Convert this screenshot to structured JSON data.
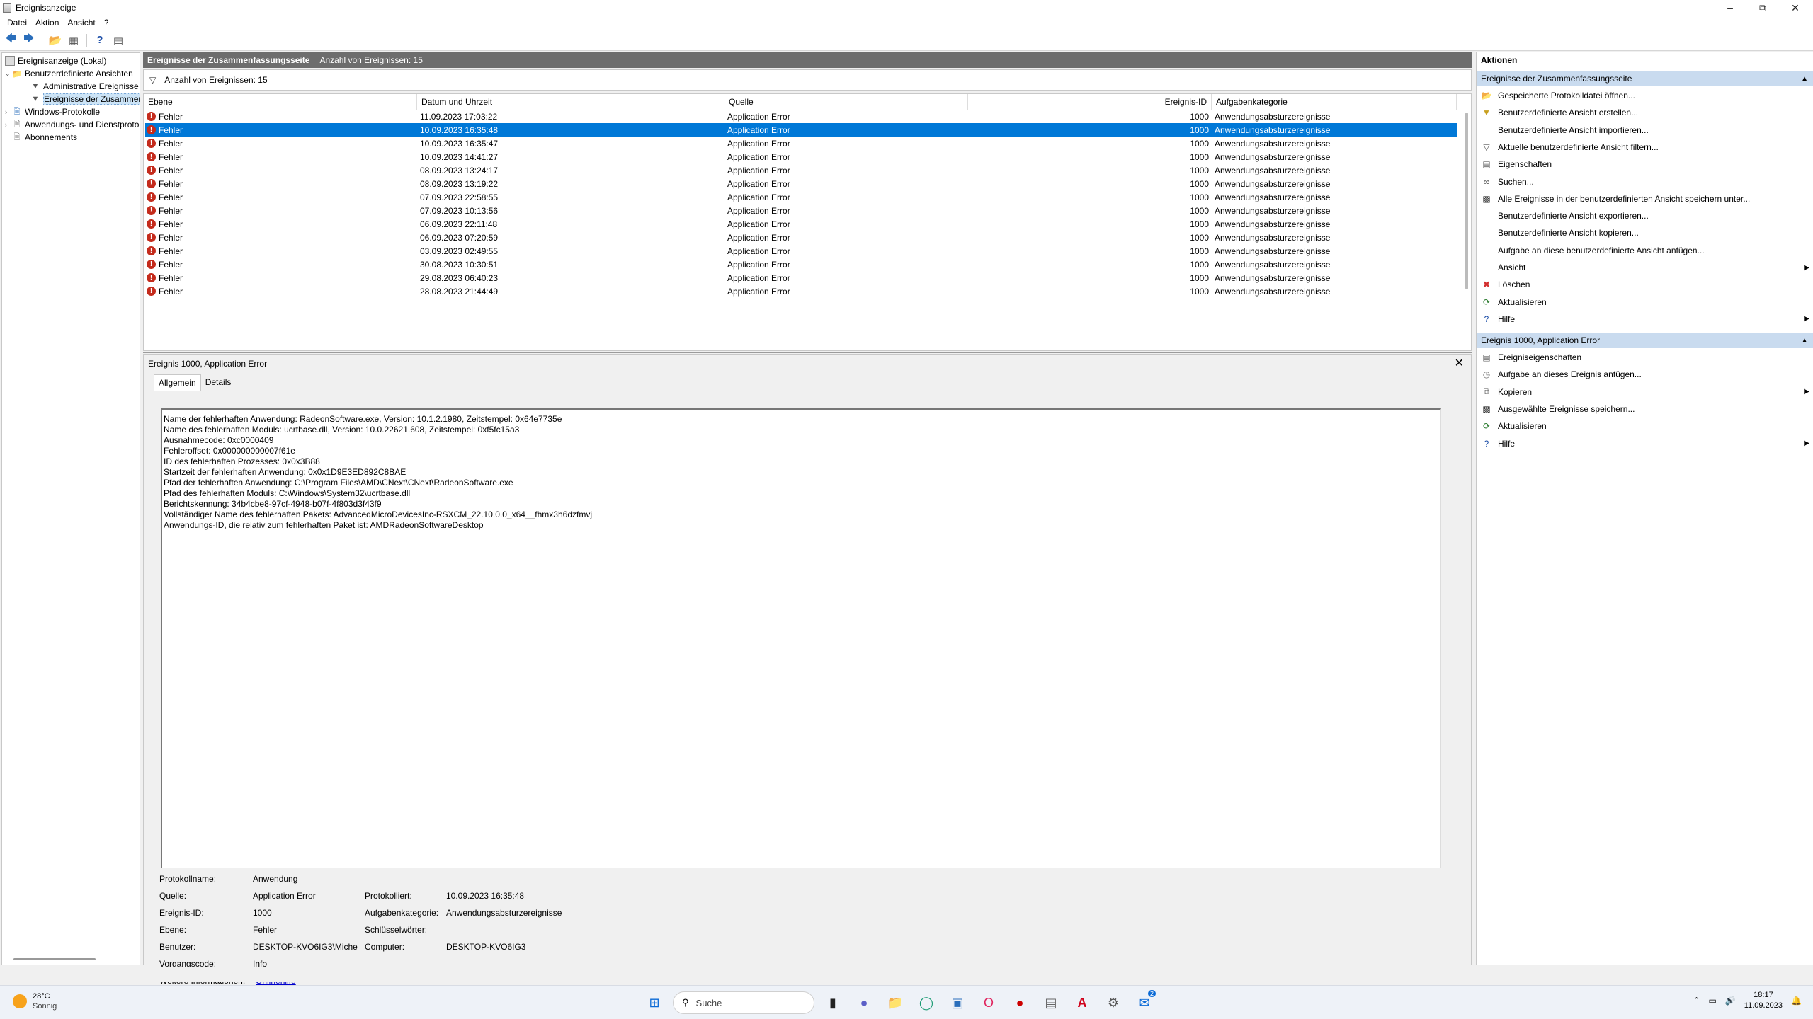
{
  "window": {
    "title": "Ereignisanzeige"
  },
  "menu": [
    "Datei",
    "Aktion",
    "Ansicht",
    "?"
  ],
  "tree": {
    "root": "Ereignisanzeige (Lokal)",
    "custom_views": "Benutzerdefinierte Ansichten",
    "admin_events": "Administrative Ereignisse",
    "summary_events": "Ereignisse der Zusammenfassungsseite",
    "windows_logs": "Windows-Protokolle",
    "app_service_logs": "Anwendungs- und Dienstprotokolle",
    "subscriptions": "Abonnements"
  },
  "center": {
    "header_title": "Ereignisse der Zusammenfassungsseite",
    "header_count": "Anzahl von Ereignissen: 15",
    "filter_text": "Anzahl von Ereignissen: 15",
    "columns": [
      "Ebene",
      "Datum und Uhrzeit",
      "Quelle",
      "Ereignis-ID",
      "Aufgabenkategorie"
    ]
  },
  "events": [
    {
      "level": "Fehler",
      "datetime": "11.09.2023 17:03:22",
      "source": "Application Error",
      "id": "1000",
      "category": "Anwendungsabsturzereignisse"
    },
    {
      "level": "Fehler",
      "datetime": "10.09.2023 16:35:48",
      "source": "Application Error",
      "id": "1000",
      "category": "Anwendungsabsturzereignisse"
    },
    {
      "level": "Fehler",
      "datetime": "10.09.2023 16:35:47",
      "source": "Application Error",
      "id": "1000",
      "category": "Anwendungsabsturzereignisse"
    },
    {
      "level": "Fehler",
      "datetime": "10.09.2023 14:41:27",
      "source": "Application Error",
      "id": "1000",
      "category": "Anwendungsabsturzereignisse"
    },
    {
      "level": "Fehler",
      "datetime": "08.09.2023 13:24:17",
      "source": "Application Error",
      "id": "1000",
      "category": "Anwendungsabsturzereignisse"
    },
    {
      "level": "Fehler",
      "datetime": "08.09.2023 13:19:22",
      "source": "Application Error",
      "id": "1000",
      "category": "Anwendungsabsturzereignisse"
    },
    {
      "level": "Fehler",
      "datetime": "07.09.2023 22:58:55",
      "source": "Application Error",
      "id": "1000",
      "category": "Anwendungsabsturzereignisse"
    },
    {
      "level": "Fehler",
      "datetime": "07.09.2023 10:13:56",
      "source": "Application Error",
      "id": "1000",
      "category": "Anwendungsabsturzereignisse"
    },
    {
      "level": "Fehler",
      "datetime": "06.09.2023 22:11:48",
      "source": "Application Error",
      "id": "1000",
      "category": "Anwendungsabsturzereignisse"
    },
    {
      "level": "Fehler",
      "datetime": "06.09.2023 07:20:59",
      "source": "Application Error",
      "id": "1000",
      "category": "Anwendungsabsturzereignisse"
    },
    {
      "level": "Fehler",
      "datetime": "03.09.2023 02:49:55",
      "source": "Application Error",
      "id": "1000",
      "category": "Anwendungsabsturzereignisse"
    },
    {
      "level": "Fehler",
      "datetime": "30.08.2023 10:30:51",
      "source": "Application Error",
      "id": "1000",
      "category": "Anwendungsabsturzereignisse"
    },
    {
      "level": "Fehler",
      "datetime": "29.08.2023 06:40:23",
      "source": "Application Error",
      "id": "1000",
      "category": "Anwendungsabsturzereignisse"
    },
    {
      "level": "Fehler",
      "datetime": "28.08.2023 21:44:49",
      "source": "Application Error",
      "id": "1000",
      "category": "Anwendungsabsturzereignisse"
    }
  ],
  "selected_event_index": 1,
  "detail": {
    "title": "Ereignis 1000, Application Error",
    "tabs": [
      "Allgemein",
      "Details"
    ],
    "message_lines": [
      "Name der fehlerhaften Anwendung: RadeonSoftware.exe, Version: 10.1.2.1980, Zeitstempel: 0x64e7735e",
      "Name des fehlerhaften Moduls: ucrtbase.dll, Version: 10.0.22621.608, Zeitstempel: 0xf5fc15a3",
      "Ausnahmecode: 0xc0000409",
      "Fehleroffset: 0x000000000007f61e",
      "ID des fehlerhaften Prozesses: 0x0x3B88",
      "Startzeit der fehlerhaften Anwendung: 0x0x1D9E3ED892C8BAE",
      "Pfad der fehlerhaften Anwendung: C:\\Program Files\\AMD\\CNext\\CNext\\RadeonSoftware.exe",
      "Pfad des fehlerhaften Moduls: C:\\Windows\\System32\\ucrtbase.dll",
      "Berichtskennung: 34b4cbe8-97cf-4948-b07f-4f803d3f43f9",
      "Vollständiger Name des fehlerhaften Pakets: AdvancedMicroDevicesInc-RSXCM_22.10.0.0_x64__fhmx3h6dzfmvj",
      "Anwendungs-ID, die relativ zum fehlerhaften Paket ist: AMDRadeonSoftwareDesktop"
    ],
    "props": {
      "log_name_label": "Protokollname:",
      "log_name": "Anwendung",
      "source_label": "Quelle:",
      "source": "Application Error",
      "logged_label": "Protokolliert:",
      "logged": "10.09.2023 16:35:48",
      "event_id_label": "Ereignis-ID:",
      "event_id": "1000",
      "task_cat_label": "Aufgabenkategorie:",
      "task_cat": "Anwendungsabsturzereignisse",
      "level_label": "Ebene:",
      "level": "Fehler",
      "keywords_label": "Schlüsselwörter:",
      "keywords": "",
      "user_label": "Benutzer:",
      "user": "DESKTOP-KVO6IG3\\Miche",
      "computer_label": "Computer:",
      "computer": "DESKTOP-KVO6IG3",
      "opcode_label": "Vorgangscode:",
      "opcode": "Info",
      "more_info_label": "Weitere Informationen:",
      "more_info_link": "Onlinehilfe"
    }
  },
  "actions": {
    "title": "Aktionen",
    "section1": "Ereignisse der Zusammenfassungsseite",
    "items1": [
      {
        "label": "Gespeicherte Protokolldatei öffnen...",
        "icon": "folder-icon"
      },
      {
        "label": "Benutzerdefinierte Ansicht erstellen...",
        "icon": "filter-create-icon"
      },
      {
        "label": "Benutzerdefinierte Ansicht importieren...",
        "icon": "none"
      },
      {
        "label": "Aktuelle benutzerdefinierte Ansicht filtern...",
        "icon": "filter-icon"
      },
      {
        "label": "Eigenschaften",
        "icon": "properties-icon"
      },
      {
        "label": "Suchen...",
        "icon": "binoculars-icon"
      },
      {
        "label": "Alle Ereignisse in der benutzerdefinierten Ansicht speichern unter...",
        "icon": "save-icon"
      },
      {
        "label": "Benutzerdefinierte Ansicht exportieren...",
        "icon": "none"
      },
      {
        "label": "Benutzerdefinierte Ansicht kopieren...",
        "icon": "none"
      },
      {
        "label": "Aufgabe an diese benutzerdefinierte Ansicht anfügen...",
        "icon": "none"
      },
      {
        "label": "Ansicht",
        "icon": "none",
        "submenu": true
      },
      {
        "label": "Löschen",
        "icon": "delete-icon"
      },
      {
        "label": "Aktualisieren",
        "icon": "refresh-icon"
      },
      {
        "label": "Hilfe",
        "icon": "help-icon",
        "submenu": true
      }
    ],
    "section2": "Ereignis 1000, Application Error",
    "items2": [
      {
        "label": "Ereigniseigenschaften",
        "icon": "properties-icon"
      },
      {
        "label": "Aufgabe an dieses Ereignis anfügen...",
        "icon": "task-icon"
      },
      {
        "label": "Kopieren",
        "icon": "copy-icon",
        "submenu": true
      },
      {
        "label": "Ausgewählte Ereignisse speichern...",
        "icon": "save-icon"
      },
      {
        "label": "Aktualisieren",
        "icon": "refresh-icon"
      },
      {
        "label": "Hilfe",
        "icon": "help-icon",
        "submenu": true
      }
    ]
  },
  "taskbar": {
    "temp": "28°C",
    "weather": "Sonnig",
    "search_placeholder": "Suche",
    "time": "18:17",
    "date": "11.09.2023",
    "badge": "2"
  },
  "colors": {
    "selection": "#0078d7",
    "header_bar": "#6d6d6d",
    "actions_section": "#c9dbef",
    "error_red": "#c42b1c"
  }
}
